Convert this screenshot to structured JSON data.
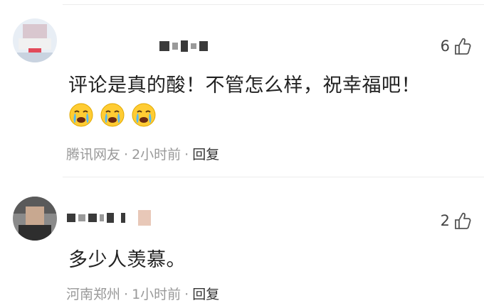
{
  "comments": [
    {
      "text": "评论是真的酸！不管怎么样，祝幸福吧！",
      "emojis": [
        "crying-emoji",
        "crying-emoji",
        "crying-emoji"
      ],
      "location": "腾讯网友",
      "time": "2小时前",
      "reply_label": "回复",
      "likes": "6"
    },
    {
      "text": "多少人羡慕。",
      "location": "河南郑州",
      "time": "1小时前",
      "reply_label": "回复",
      "likes": "2"
    }
  ],
  "colors": {
    "meta_gray": "#999999",
    "text": "#222222",
    "emoji_yellow": "#ffcc33"
  }
}
